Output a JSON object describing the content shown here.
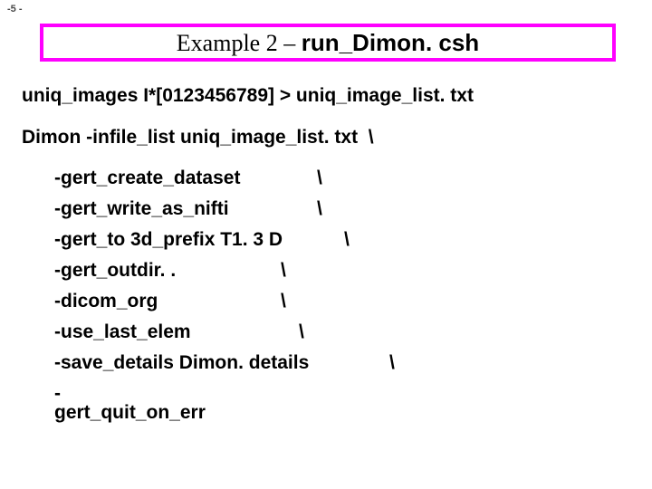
{
  "page_number": "-5 -",
  "title": {
    "prefix": "Example 2 – ",
    "command": "run_Dimon. csh"
  },
  "lines": {
    "uniq": "uniq_images I*[0123456789] > uniq_image_list. txt",
    "dimon": "Dimon -infile_list uniq_image_list. txt  \\"
  },
  "flags": [
    {
      "text": "-gert_create_dataset",
      "pad": 290,
      "cont": "\\"
    },
    {
      "text": "-gert_write_as_nifti",
      "pad": 290,
      "cont": "\\"
    },
    {
      "text": "-gert_to 3d_prefix T1. 3 D",
      "pad": 320,
      "cont": "\\"
    },
    {
      "text": "-gert_outdir. .",
      "pad": 250,
      "cont": "\\"
    },
    {
      "text": "-dicom_org",
      "pad": 250,
      "cont": "\\"
    },
    {
      "text": "-use_last_elem",
      "pad": 270,
      "cont": "\\"
    },
    {
      "text": "-save_details Dimon. details",
      "pad": 370,
      "cont": "\\"
    },
    {
      "text": "-gert_quit_on_err",
      "pad": 0,
      "cont": ""
    }
  ]
}
